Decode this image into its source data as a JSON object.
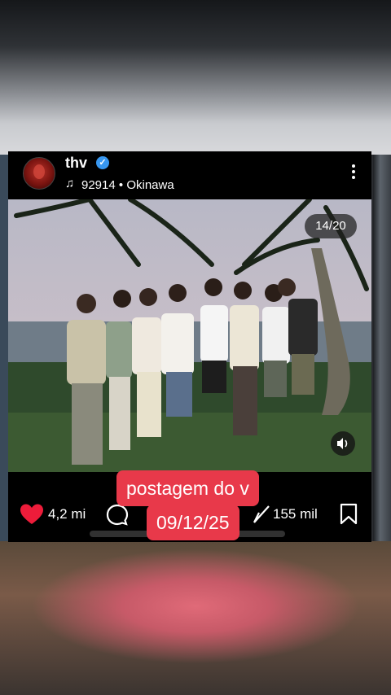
{
  "post": {
    "username": "thv",
    "verified": true,
    "music_count": "92914",
    "separator": " • ",
    "location": "Okinawa",
    "carousel_counter": "14/20",
    "likes": "4,2 mi",
    "shares": "155 mil"
  },
  "overlay": {
    "line1": "postagem do v",
    "line2": "09/12/25"
  },
  "icons": {
    "verified": "verified-badge-icon",
    "music": "music-note-icon",
    "more": "more-vertical-icon",
    "sound": "speaker-icon",
    "like": "heart-icon",
    "comment": "comment-icon",
    "share": "share-icon",
    "save": "bookmark-icon"
  },
  "colors": {
    "like_red": "#ed1c3a",
    "verified_blue": "#3897f0",
    "overlay_red": "#e8394a"
  }
}
